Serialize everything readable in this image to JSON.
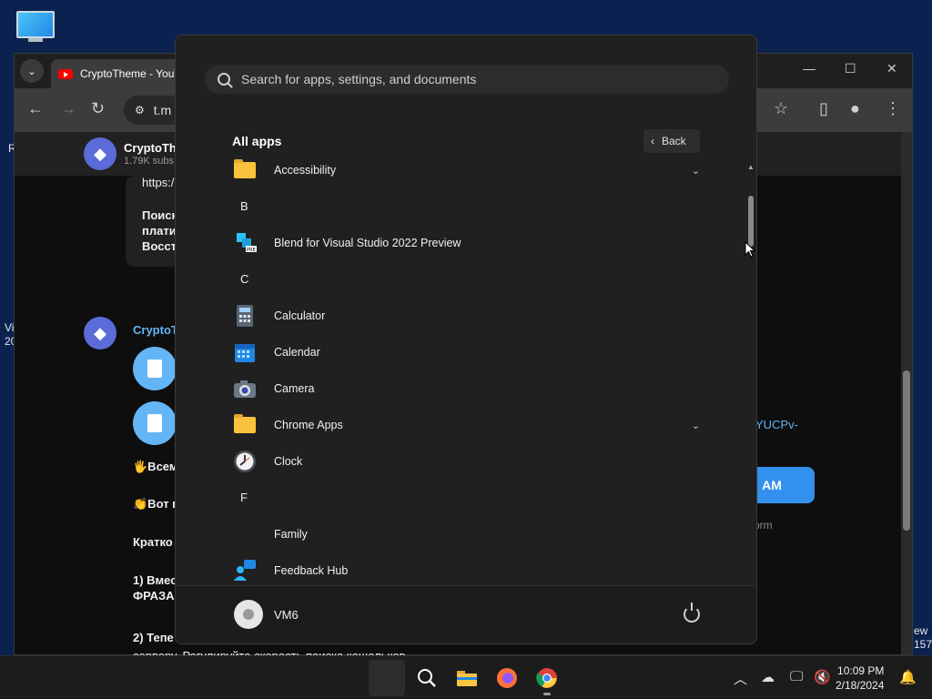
{
  "desktop": {
    "edge_left": [
      "R",
      "Vi",
      "20"
    ],
    "edge_right": [
      "ew",
      "157"
    ]
  },
  "chrome": {
    "tab_title": "CryptoTheme - YouT",
    "url": "t.m",
    "page": {
      "channel_name": "CryptoTh",
      "subscribers": "1.79K subs",
      "post_link": "https:/",
      "post_lines": [
        "Поиск",
        "плати",
        "Восст"
      ],
      "sender_name": "CryptoTh",
      "messages": [
        "🖐️Всем",
        "👏Вот п",
        "Кратко",
        "1) Вмес",
        "ФРАЗА",
        "2) Тепе",
        "серверу. Регулируйте скорость поиска кошельков"
      ],
      "right_link": "YUCPv-",
      "right_button": "AM",
      "right_footer": "orm"
    }
  },
  "start_menu": {
    "search_placeholder": "Search for apps, settings, and documents",
    "all_apps_title": "All apps",
    "back_label": "Back",
    "items": [
      {
        "kind": "app",
        "label": "Accessibility",
        "icon": "folder-icon",
        "expandable": true
      },
      {
        "kind": "letter",
        "label": "B"
      },
      {
        "kind": "app",
        "label": "Blend for Visual Studio 2022 Preview",
        "icon": "blend-icon"
      },
      {
        "kind": "letter",
        "label": "C"
      },
      {
        "kind": "app",
        "label": "Calculator",
        "icon": "calculator-icon"
      },
      {
        "kind": "app",
        "label": "Calendar",
        "icon": "calendar-icon"
      },
      {
        "kind": "app",
        "label": "Camera",
        "icon": "camera-icon"
      },
      {
        "kind": "app",
        "label": "Chrome Apps",
        "icon": "folder-icon",
        "expandable": true
      },
      {
        "kind": "app",
        "label": "Clock",
        "icon": "clock-icon"
      },
      {
        "kind": "letter",
        "label": "F"
      },
      {
        "kind": "app",
        "label": "Family",
        "icon": "family-icon"
      },
      {
        "kind": "app",
        "label": "Feedback Hub",
        "icon": "feedback-hub-icon"
      }
    ],
    "user_name": "VM6"
  },
  "taskbar": {
    "time": "10:09 PM",
    "date": "2/18/2024"
  }
}
